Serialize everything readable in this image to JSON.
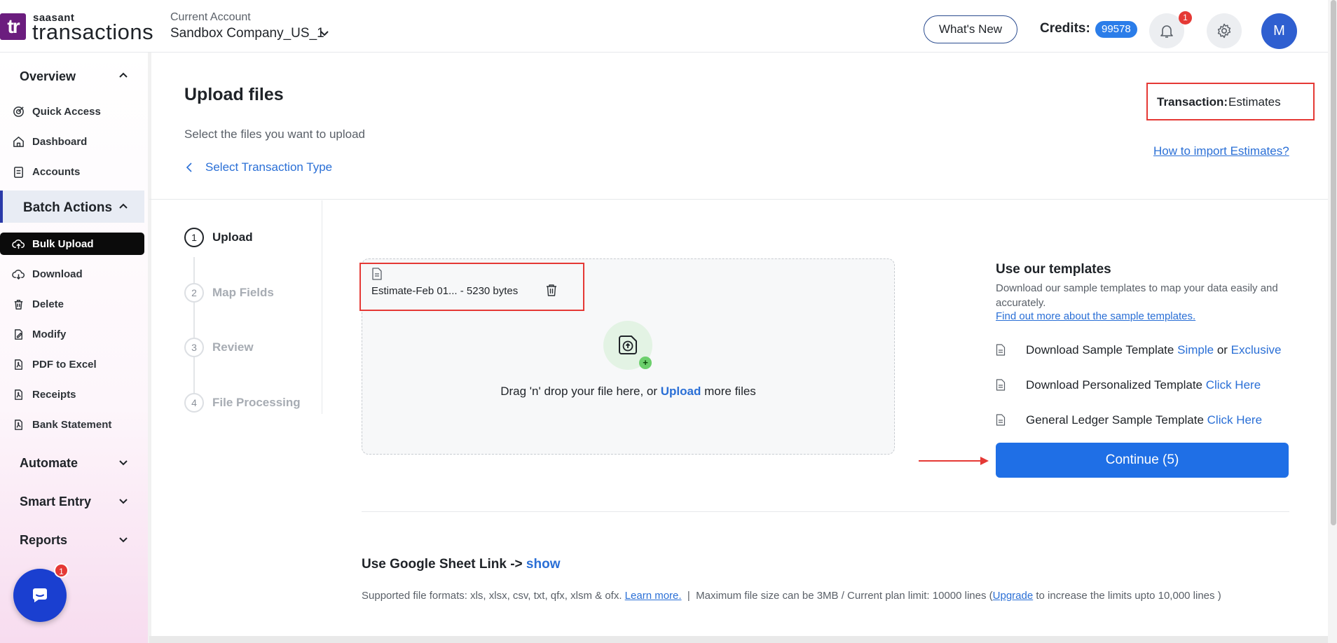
{
  "header": {
    "logo_mark": "tr",
    "logo_small": "saasant",
    "logo_main": "transactions",
    "account_label": "Current Account",
    "account_name": "Sandbox Company_US_1",
    "whats_new": "What's New",
    "credits_label": "Credits:",
    "credits_value": "99578",
    "notification_count": "1",
    "avatar_initial": "M"
  },
  "sidebar": {
    "sections": [
      {
        "label": "Overview",
        "icon": "chevron-up-icon"
      },
      {
        "label": "Batch Actions",
        "icon": "chevron-up-icon"
      },
      {
        "label": "Automate",
        "icon": "chevron-down-icon"
      },
      {
        "label": "Smart Entry",
        "icon": "chevron-down-icon"
      },
      {
        "label": "Reports",
        "icon": "chevron-down-icon"
      }
    ],
    "overview_items": [
      {
        "label": "Quick Access",
        "icon": "target-icon"
      },
      {
        "label": "Dashboard",
        "icon": "home-icon"
      },
      {
        "label": "Accounts",
        "icon": "clipboard-icon"
      }
    ],
    "batch_items": [
      {
        "label": "Bulk Upload",
        "icon": "cloud-upload-icon"
      },
      {
        "label": "Download",
        "icon": "cloud-download-icon"
      },
      {
        "label": "Delete",
        "icon": "trash-icon"
      },
      {
        "label": "Modify",
        "icon": "edit-file-icon"
      },
      {
        "label": "PDF to Excel",
        "icon": "pdf-file-icon"
      },
      {
        "label": "Receipts",
        "icon": "receipt-icon"
      },
      {
        "label": "Bank Statement",
        "icon": "bank-file-icon"
      }
    ],
    "chat_badge": "1"
  },
  "main": {
    "title": "Upload files",
    "subtitle": "Select the files you want to upload",
    "back_link": "Select Transaction Type",
    "transaction_key": "Transaction:",
    "transaction_value": "Estimates",
    "howto_link": "How to import Estimates?",
    "steps": [
      {
        "num": "1",
        "label": "Upload"
      },
      {
        "num": "2",
        "label": "Map Fields"
      },
      {
        "num": "3",
        "label": "Review"
      },
      {
        "num": "4",
        "label": "File Processing"
      }
    ],
    "file_name": "Estimate-Feb 01... - 5230 bytes",
    "drop_before": "Drag 'n' drop your file here, or",
    "drop_link": "Upload",
    "drop_after": "more files",
    "plus": "+"
  },
  "templates": {
    "title": "Use our templates",
    "desc": "Download our sample templates to map your data easily and accurately.",
    "more_link": "Find out more about the sample templates.",
    "row1_text": "Download Sample Template",
    "row1_link1": "Simple",
    "row1_or": "or",
    "row1_link2": "Exclusive",
    "row2_text": "Download Personalized Template",
    "row2_link": "Click Here",
    "row3_text": "General Ledger Sample Template",
    "row3_link": "Click Here",
    "continue": "Continue (5)"
  },
  "footer": {
    "gsheet_label": "Use Google Sheet Link ->",
    "gsheet_link": "show",
    "formats": "Supported file formats: xls, xlsx, csv, txt, qfx, xlsm & ofx.",
    "learn_more": "Learn more.",
    "sep": "|",
    "limits": "Maximum file size can be 3MB / Current plan limit: 10000 lines (",
    "upgrade": "Upgrade",
    "limits_end": "to increase the limits upto 10,000 lines )"
  },
  "colors": {
    "accent": "#1f6fe6",
    "link": "#2a6fd6",
    "highlight": "#e53935",
    "brand": "#6b1d7e"
  }
}
